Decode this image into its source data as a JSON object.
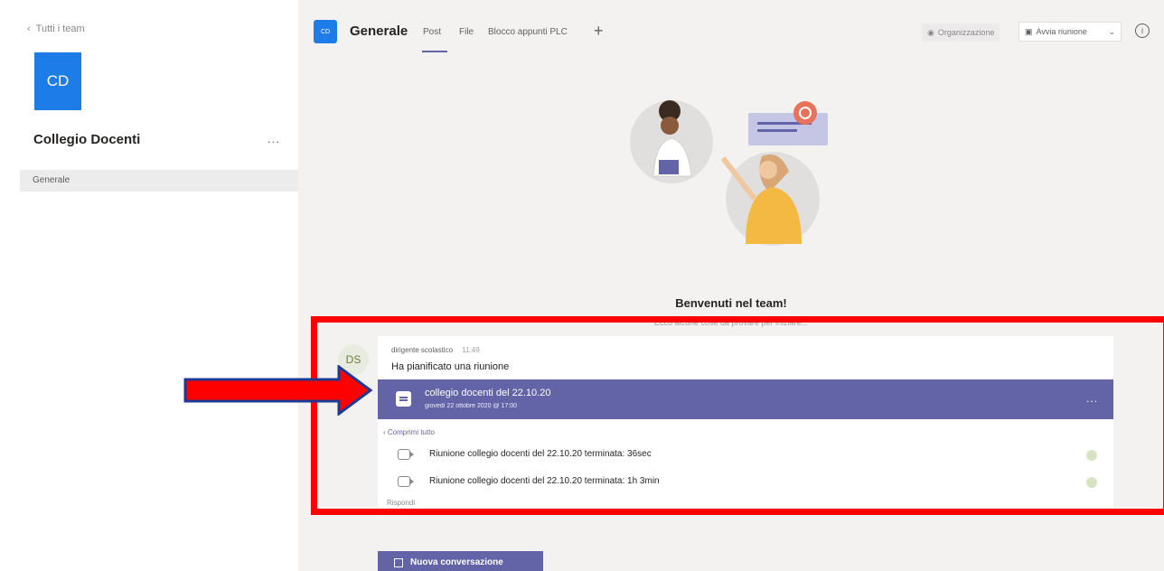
{
  "sidebar": {
    "back_label": "Tutti i team",
    "team_initials": "CD",
    "team_name": "Collegio Docenti",
    "more": "...",
    "channels": [
      "Generale"
    ]
  },
  "header": {
    "channel_initials": "CD",
    "channel_title": "Generale",
    "tabs": [
      "Post",
      "File",
      "Blocco appunti PLC"
    ],
    "add_tab": "+",
    "org_label": "Organizzazione",
    "meet_label": "Avvia riunione",
    "info": "i"
  },
  "welcome": {
    "title": "Benvenuti nel team!",
    "subtitle": "Ecco alcune cose da provare per iniziare..."
  },
  "message": {
    "avatar": "DS",
    "author": "dirigente scolastico",
    "time": "11:49",
    "text": "Ha pianificato una riunione",
    "meeting_title": "collegio docenti del 22.10.20",
    "meeting_date": "giovedì 22 ottobre 2020 @ 17:00",
    "meeting_more": "...",
    "collapse_label": "Comprimi tutto",
    "replies": [
      "Riunione collegio docenti del 22.10.20 terminata: 36sec",
      "Riunione collegio docenti del 22.10.20 terminata: 1h 3min"
    ],
    "more_label": "Rispondi"
  },
  "new_conversation_label": "Nuova conversazione",
  "colors": {
    "teams_purple": "#6264a7",
    "team_blue": "#1e7ce8",
    "annotation_red": "#ff0000",
    "annotation_arrow_outline": "#1f3a93"
  }
}
